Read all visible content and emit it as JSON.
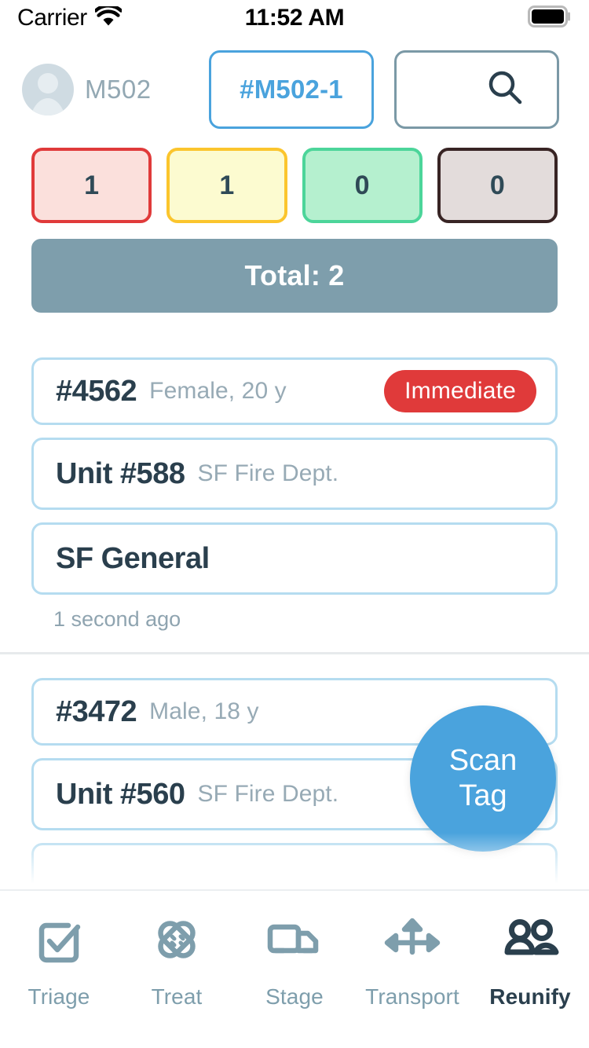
{
  "status_bar": {
    "carrier": "Carrier",
    "time": "11:52 AM",
    "wifi_icon": "wifi-icon",
    "battery_icon": "battery-full-icon"
  },
  "header": {
    "avatar_icon": "user-avatar-icon",
    "user_name": "M502",
    "incident_label": "#M502-1",
    "search_icon": "search-icon",
    "accent_blue": "#4aa3dd"
  },
  "counters": [
    {
      "name": "immediate",
      "count": "1",
      "border": "#e03a3a",
      "fill": "#fbe0dc"
    },
    {
      "name": "delayed",
      "count": "1",
      "border": "#fbc52d",
      "fill": "#fcfbd0"
    },
    {
      "name": "minor",
      "count": "0",
      "border": "#4cd59a",
      "fill": "#b5f0cf"
    },
    {
      "name": "deceased",
      "count": "0",
      "border": "#382424",
      "fill": "#e3dcdb"
    }
  ],
  "total": {
    "label": "Total: 2",
    "background": "#7e9eac"
  },
  "patients": [
    {
      "id": "#4562",
      "demographics": "Female, 20 y",
      "badge": "Immediate",
      "badge_color": "#e03a3a",
      "unit": "Unit #588",
      "agency": "SF Fire Dept.",
      "destination": "SF General",
      "timestamp": "1 second ago"
    },
    {
      "id": "#3472",
      "demographics": "Male, 18 y",
      "badge": "",
      "badge_color": "",
      "unit": "Unit #560",
      "agency": "SF Fire Dept.",
      "destination": "",
      "timestamp": ""
    }
  ],
  "fab": {
    "line1": "Scan",
    "line2": "Tag",
    "color": "#4aa3dd"
  },
  "tabs": [
    {
      "label": "Triage",
      "icon": "checkbox-check-icon",
      "active": false
    },
    {
      "label": "Treat",
      "icon": "bandage-icon",
      "active": false
    },
    {
      "label": "Stage",
      "icon": "truck-icon",
      "active": false
    },
    {
      "label": "Transport",
      "icon": "arrows-three-way-icon",
      "active": false
    },
    {
      "label": "Reunify",
      "icon": "people-group-icon",
      "active": true
    }
  ]
}
